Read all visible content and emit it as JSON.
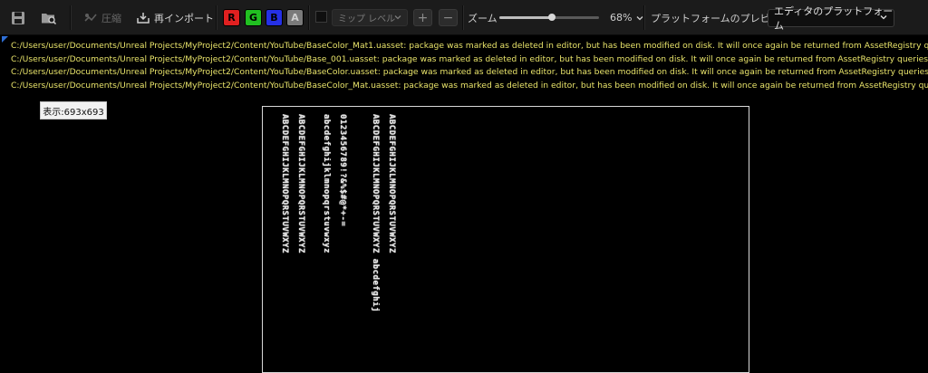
{
  "toolbar": {
    "save_icon": "save-icon",
    "browse_icon": "folder-search-icon",
    "compress_label": "圧縮",
    "reimport_label": "再インポート",
    "channels": [
      {
        "label": "R",
        "color": "#e02020"
      },
      {
        "label": "G",
        "color": "#21c021"
      },
      {
        "label": "B",
        "color": "#2530e6"
      },
      {
        "label": "A",
        "color": "#7a7a7a"
      }
    ],
    "mip_label": "ミップ レベル",
    "zoom_in_label": "+",
    "zoom_out_label": "−",
    "zoom_label": "ズーム",
    "zoom_value": "68%",
    "zoom_fraction": 0.53,
    "platform_preview_label": "プラットフォームのプレビュー:",
    "platform_value": "エディタのプラットフォーム"
  },
  "viewport": {
    "log_lines": [
      "C:/Users/user/Documents/Unreal Projects/MyProject2/Content/YouTube/BaseColor_Mat1.uasset: package was marked as deleted in editor, but has been modified on disk. It will once again be returned from AssetRegistry queries.",
      "C:/Users/user/Documents/Unreal Projects/MyProject2/Content/YouTube/Base_001.uasset: package was marked as deleted in editor, but has been modified on disk. It will once again be returned from AssetRegistry queries.",
      "C:/Users/user/Documents/Unreal Projects/MyProject2/Content/YouTube/BaseColor.uasset: package was marked as deleted in editor, but has been modified on disk. It will once again be returned from AssetRegistry queries.",
      "C:/Users/user/Documents/Unreal Projects/MyProject2/Content/YouTube/BaseColor_Mat.uasset: package was marked as deleted in editor, but has been modified on disk. It will once again be returned from AssetRegistry queries."
    ],
    "size_tooltip": "表示:693x693",
    "texture_columns": [
      "ABCDEFGHIJKLMNOPQRSTUVWXYZ",
      "abcdefghijklmnopqrstuvwxyz",
      "0123456789!?&%$#@*+-=",
      "ABCDEFGHIJKLMNOPQRSTUVWXYZ abcdefghij",
      "ABCDEFGHIJKLMNOPQRSTUVWXYZ"
    ]
  }
}
